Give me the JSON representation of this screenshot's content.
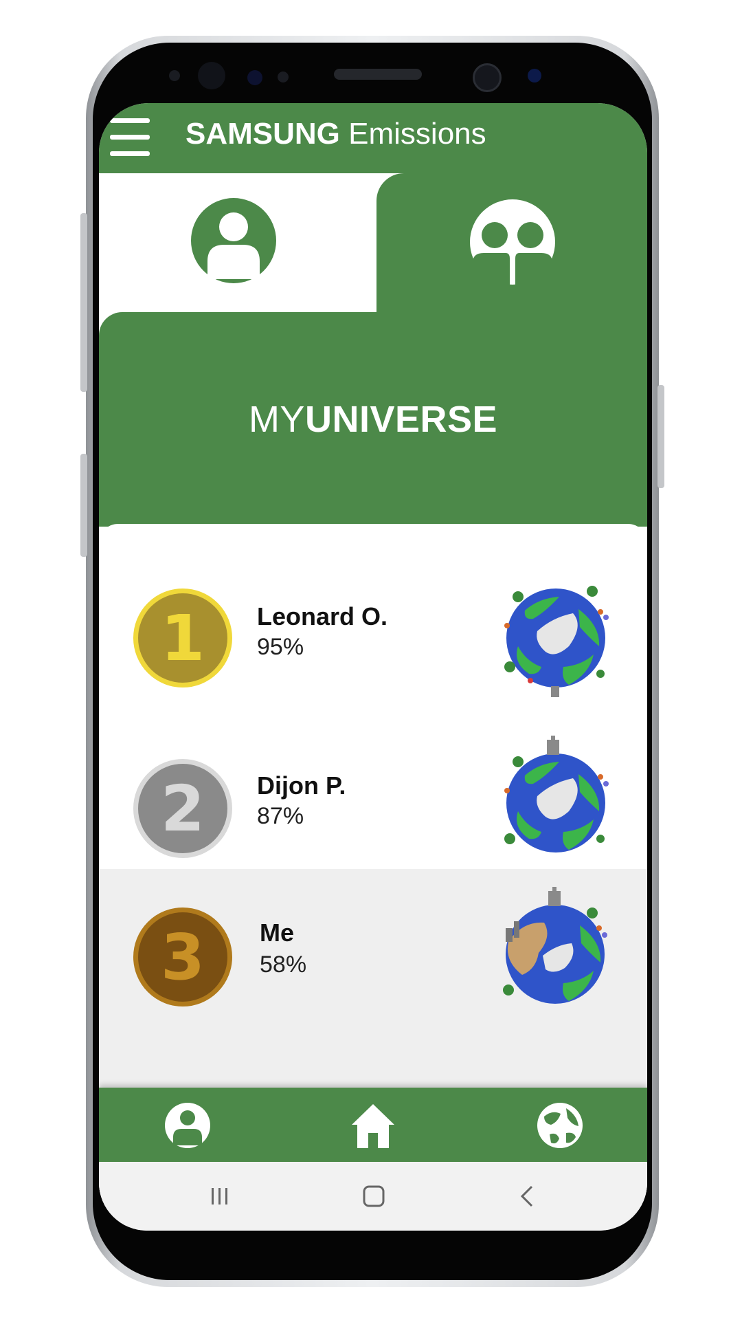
{
  "header": {
    "brand": "SAMSUNG",
    "app_name": "Emissions"
  },
  "tabs": {
    "personal": "person-icon",
    "group": "group-icon",
    "selected": "personal"
  },
  "banner": {
    "title_light": "MY",
    "title_bold": "UNIVERSE"
  },
  "leaderboard": [
    {
      "rank": "1",
      "name": "Leonard O.",
      "percent": "95%",
      "medal_color": "#f0d83a",
      "medal_inner": "#a8902e",
      "digit_color": "#f0d83a"
    },
    {
      "rank": "2",
      "name": "Dijon P.",
      "percent": "87%",
      "medal_color": "#d9d9d9",
      "medal_inner": "#8a8a8a",
      "digit_color": "#d9d9d9"
    },
    {
      "rank": "3",
      "name": "Me",
      "percent": "58%",
      "medal_color": "#b07a1c",
      "medal_inner": "#7a4f12",
      "digit_color": "#c89026"
    }
  ],
  "bottom_nav": [
    "profile-icon",
    "home-icon",
    "globe-icon"
  ],
  "system_nav": [
    "recents-icon",
    "home-button-icon",
    "back-icon"
  ],
  "colors": {
    "primary_green": "#4c8949",
    "ocean": "#2f54c9",
    "land": "#3cb54a",
    "pollution": "#c8a06c"
  }
}
